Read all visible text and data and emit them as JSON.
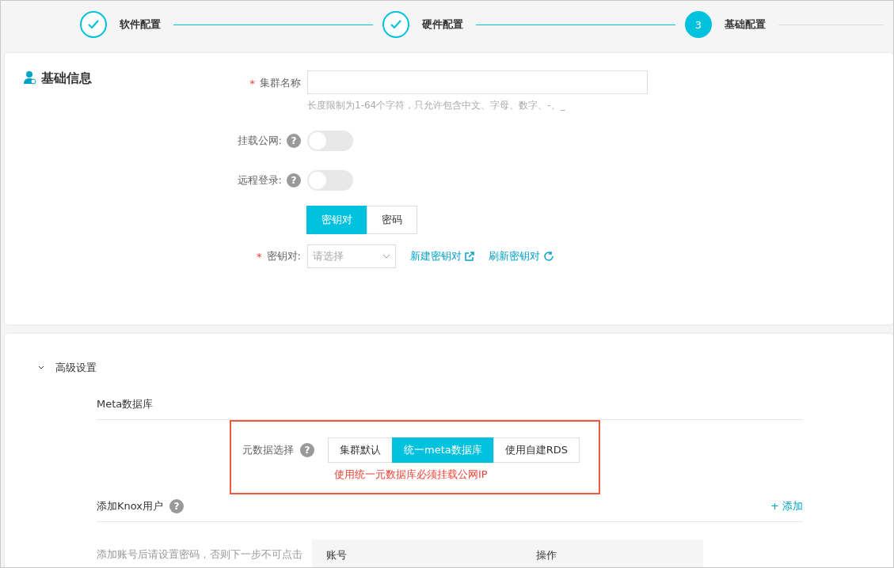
{
  "steps": [
    {
      "label": "软件配置",
      "done": true
    },
    {
      "label": "硬件配置",
      "done": true
    },
    {
      "label": "基础配置",
      "done": false,
      "number": "3"
    }
  ],
  "basic": {
    "title": "基础信息",
    "cluster_name": {
      "label": "集群名称",
      "required_mark": "*",
      "hint": "长度限制为1-64个字符，只允许包含中文、字母、数字、-、_"
    },
    "switches": [
      {
        "label": "挂载公网:",
        "help": "?",
        "on": false
      },
      {
        "label": "远程登录:",
        "help": "?",
        "on": false
      }
    ],
    "login_modes": [
      {
        "label": "密钥对",
        "selected": true
      },
      {
        "label": "密码",
        "selected": false
      }
    ],
    "keypair": {
      "label": "密钥对:",
      "required_mark": "*",
      "placeholder": "请选择"
    },
    "links": [
      {
        "label": "新建密钥对",
        "kind": "external"
      },
      {
        "label": "刷新密钥对",
        "kind": "refresh"
      }
    ]
  },
  "advanced": {
    "title": "高级设置",
    "expanded": true,
    "meta_section": "Meta数据库",
    "meta_label": "元数据选择",
    "meta_help": "?",
    "meta_options": [
      {
        "label": "集群默认",
        "selected": false
      },
      {
        "label": "统一meta数据库",
        "selected": true
      },
      {
        "label": "使用自建RDS",
        "selected": false
      }
    ],
    "meta_error": "使用统一元数据库必须挂载公网IP",
    "knox_title": "添加Knox用户",
    "knox_help": "?",
    "knox_add": "+ 添加",
    "knox_hint": "添加账号后请设置密码，否则下一步不可点击",
    "knox_columns": [
      "账号",
      "操作"
    ]
  }
}
